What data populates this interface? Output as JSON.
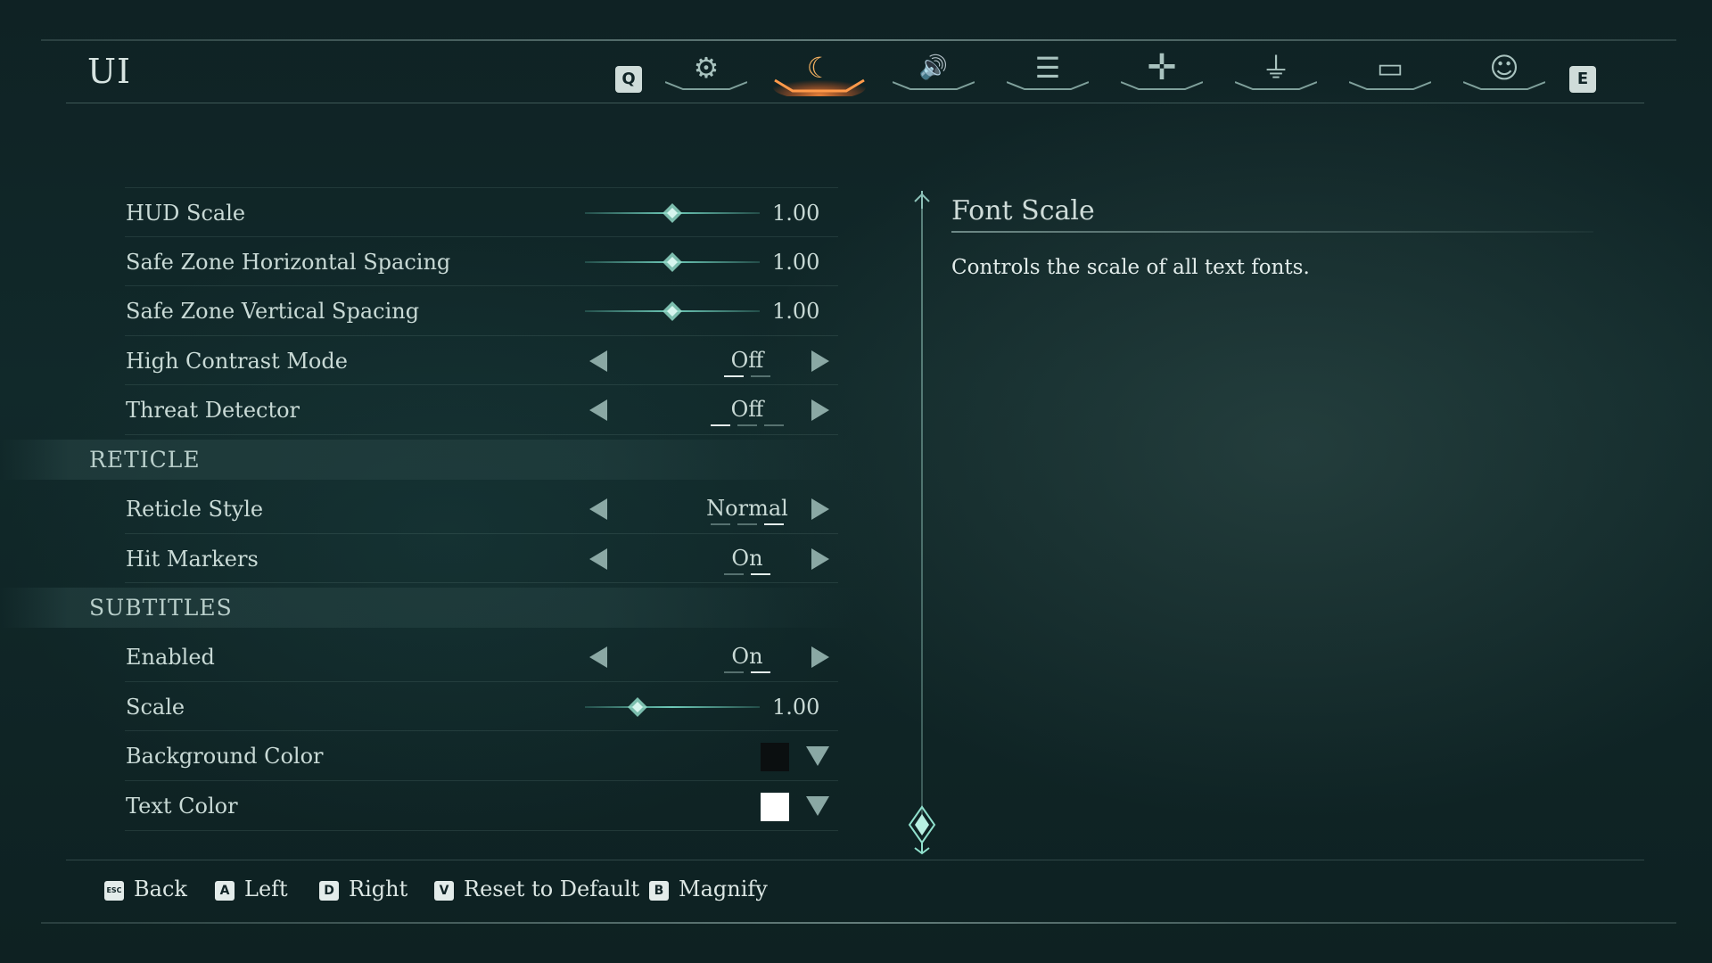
{
  "page": {
    "title": "UI"
  },
  "tabbar": {
    "prev_key": "Q",
    "next_key": "E",
    "tabs": [
      {
        "icon": "gears-icon",
        "glyph": "⚙",
        "active": false
      },
      {
        "icon": "ui-swirl-icon",
        "glyph": "☾",
        "active": true
      },
      {
        "icon": "speaker-icon",
        "glyph": "🔊",
        "active": false
      },
      {
        "icon": "list-icon",
        "glyph": "☰",
        "active": false
      },
      {
        "icon": "crosshair-move-icon",
        "glyph": "✛",
        "active": false
      },
      {
        "icon": "joystick-icon",
        "glyph": "⏚",
        "active": false
      },
      {
        "icon": "monitor-icon",
        "glyph": "▭",
        "active": false
      },
      {
        "icon": "accessibility-icon",
        "glyph": "☺",
        "active": false
      }
    ]
  },
  "settings": {
    "hud_scale": {
      "label": "HUD Scale",
      "value": "1.00",
      "fraction": 0.5
    },
    "safe_zone_h": {
      "label": "Safe Zone Horizontal Spacing",
      "value": "1.00",
      "fraction": 0.5
    },
    "safe_zone_v": {
      "label": "Safe Zone Vertical Spacing",
      "value": "1.00",
      "fraction": 0.5
    },
    "high_contrast": {
      "label": "High Contrast Mode",
      "value": "Off",
      "options_count": 2,
      "selected_index": 0
    },
    "threat_detector": {
      "label": "Threat Detector",
      "value": "Off",
      "options_count": 3,
      "selected_index": 0
    },
    "reticle_header": "RETICLE",
    "reticle_style": {
      "label": "Reticle Style",
      "value": "Normal",
      "options_count": 3,
      "selected_index": 2
    },
    "hit_markers": {
      "label": "Hit Markers",
      "value": "On",
      "options_count": 2,
      "selected_index": 1
    },
    "subtitles_header": "SUBTITLES",
    "subtitles_enabled": {
      "label": "Enabled",
      "value": "On",
      "options_count": 2,
      "selected_index": 1
    },
    "subtitles_scale": {
      "label": "Scale",
      "value": "1.00",
      "fraction": 0.3
    },
    "background_color": {
      "label": "Background Color",
      "color": "#0b0f10"
    },
    "text_color": {
      "label": "Text Color",
      "color": "#ffffff"
    }
  },
  "description": {
    "title": "Font Scale",
    "text": "Controls the scale of all text fonts."
  },
  "hints": [
    {
      "key": "ESC",
      "label": "Back"
    },
    {
      "key": "A",
      "label": "Left"
    },
    {
      "key": "D",
      "label": "Right"
    },
    {
      "key": "V",
      "label": "Reset to Default"
    },
    {
      "key": "B",
      "label": "Magnify"
    }
  ],
  "colors": {
    "accent_active": "#f4b060",
    "slider": "#78dcc8"
  }
}
